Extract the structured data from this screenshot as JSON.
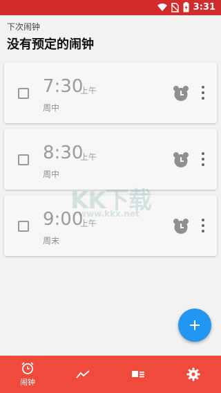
{
  "statusbar": {
    "time": "3:31",
    "icons": [
      "wifi-icon",
      "no-sim-icon",
      "battery-charging-icon"
    ]
  },
  "header": {
    "subtitle": "下次闹钟",
    "title": "没有预定的闹钟"
  },
  "alarms": [
    {
      "time": "7:30",
      "ampm": "上午",
      "days": "周中",
      "enabled": false
    },
    {
      "time": "8:30",
      "ampm": "上午",
      "days": "周中",
      "enabled": false
    },
    {
      "time": "9:00",
      "ampm": "上午",
      "days": "周末",
      "enabled": false
    }
  ],
  "watermark": {
    "big": "KK下载",
    "small": "www.kkx.net"
  },
  "fab": {
    "icon": "add-icon"
  },
  "bottom_nav": [
    {
      "icon": "alarm-clock-icon",
      "label": "闹钟",
      "active": true
    },
    {
      "icon": "trend-chart-icon",
      "label": "",
      "active": false
    },
    {
      "icon": "card-list-icon",
      "label": "",
      "active": false
    },
    {
      "icon": "gear-icon",
      "label": "",
      "active": false
    }
  ],
  "colors": {
    "statusbar": "#d22b2b",
    "bottom_nav": "#ef4a3c",
    "fab": "#2196f3",
    "background": "#f3f2f1"
  }
}
